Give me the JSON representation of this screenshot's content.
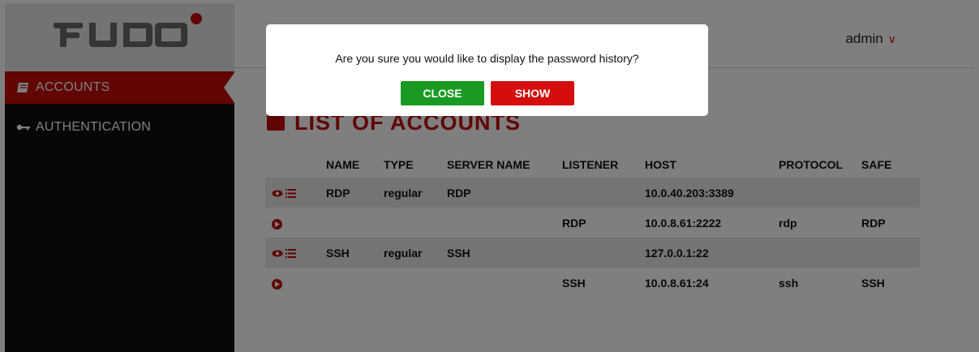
{
  "brand": {
    "logo_text": "FUDO",
    "accent": "#c20a0a"
  },
  "sidebar": {
    "items": [
      {
        "label": "ACCOUNTS",
        "icon": "book-icon",
        "active": true
      },
      {
        "label": "AUTHENTICATION",
        "icon": "key-icon",
        "active": false
      }
    ]
  },
  "header": {
    "user": "admin"
  },
  "page": {
    "title": "LIST OF ACCOUNTS"
  },
  "table": {
    "columns": [
      "NAME",
      "TYPE",
      "SERVER NAME",
      "LISTENER",
      "HOST",
      "PROTOCOL",
      "SAFE"
    ],
    "rows": [
      {
        "kind": "account",
        "actions": [
          "eye-icon",
          "list-icon"
        ],
        "name": "RDP",
        "type": "regular",
        "server": "RDP",
        "listener": "",
        "host": "10.0.40.203:3389",
        "protocol": "",
        "safe": ""
      },
      {
        "kind": "listener",
        "actions": [
          "play-icon"
        ],
        "name": "",
        "type": "",
        "server": "",
        "listener": "RDP",
        "host": "10.0.8.61:2222",
        "protocol": "rdp",
        "safe": "RDP"
      },
      {
        "kind": "account",
        "actions": [
          "eye-icon",
          "list-icon"
        ],
        "name": "SSH",
        "type": "regular",
        "server": "SSH",
        "listener": "",
        "host": "127.0.0.1:22",
        "protocol": "",
        "safe": ""
      },
      {
        "kind": "listener",
        "actions": [
          "play-icon"
        ],
        "name": "",
        "type": "",
        "server": "",
        "listener": "SSH",
        "host": "10.0.8.61:24",
        "protocol": "ssh",
        "safe": "SSH"
      }
    ]
  },
  "modal": {
    "message": "Are you sure you would like to display the password history?",
    "close_label": "CLOSE",
    "show_label": "SHOW",
    "colors": {
      "close": "#1a9a22",
      "show": "#d50d0d"
    }
  }
}
